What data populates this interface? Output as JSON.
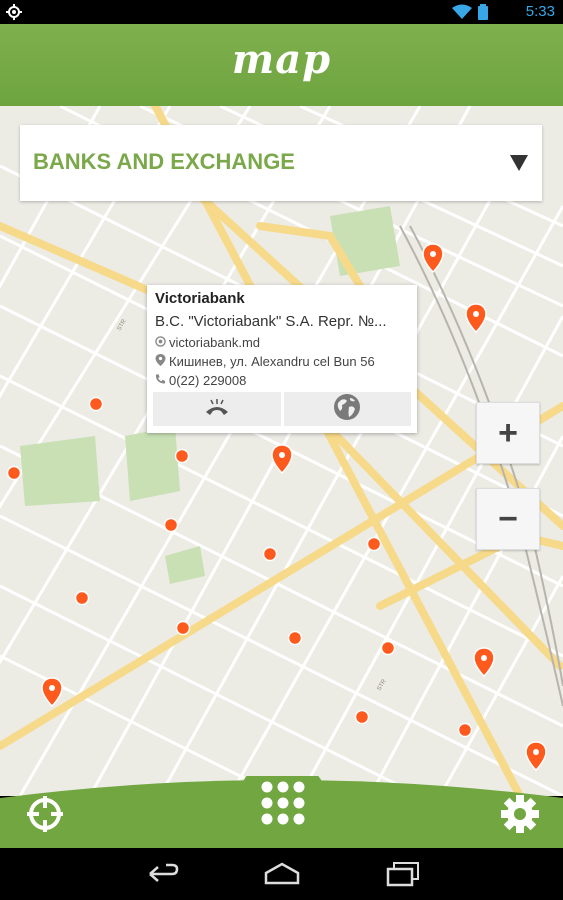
{
  "status_bar": {
    "time": "5:33"
  },
  "header": {
    "title": "map"
  },
  "category_selector": {
    "label": "BANKS AND EXCHANGE"
  },
  "popup": {
    "name": "Victoriabank",
    "description": "B.C. \"Victoriabank\" S.A. Repr. №...",
    "website": "victoriabank.md",
    "address": "Кишинев, ул. Alexandru cel Bun 56",
    "phone": "0(22) 229008"
  },
  "zoom": {
    "in_label": "+",
    "out_label": "−"
  },
  "colors": {
    "brand_green": "#74a845",
    "marker_orange": "#ff5a1e",
    "map_bg": "#ecebe4",
    "road": "#f7d98a"
  },
  "icons": {
    "locate": "crosshair-icon",
    "menu": "grid-icon",
    "settings": "gear-icon",
    "call": "phone-icon",
    "web": "globe-icon",
    "back": "back-icon",
    "home": "home-icon",
    "recent": "recent-apps-icon"
  }
}
